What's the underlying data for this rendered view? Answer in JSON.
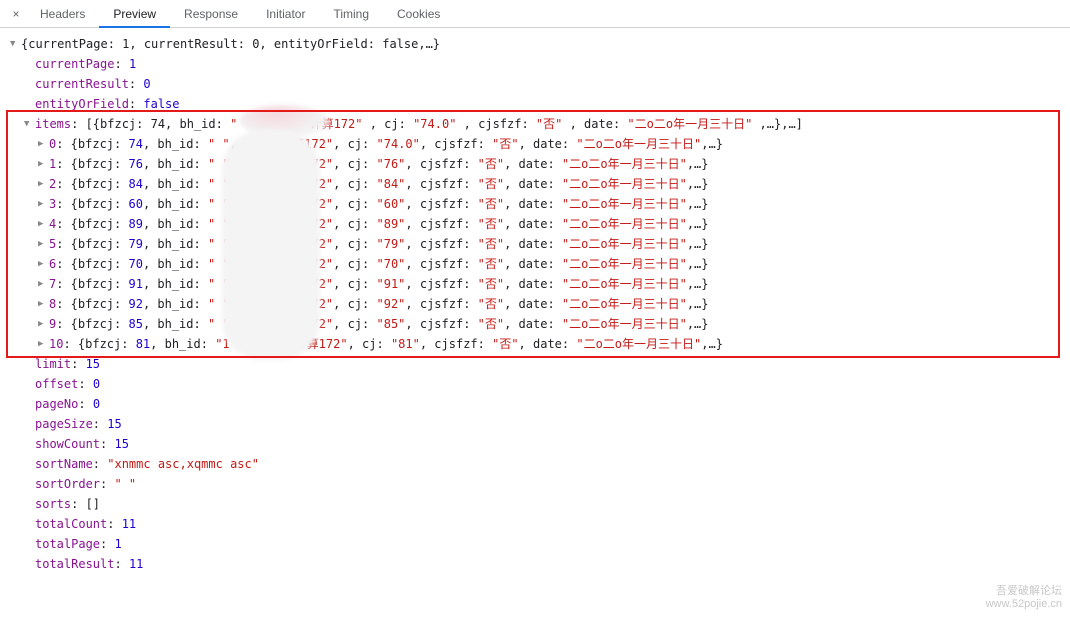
{
  "tabs": {
    "close": "×",
    "headers": "Headers",
    "preview": "Preview",
    "response": "Response",
    "initiator": "Initiator",
    "timing": "Timing",
    "cookies": "Cookies"
  },
  "glyph": {
    "down": "▼",
    "right": "▶"
  },
  "root_summary": "{currentPage: 1, currentResult: 0, entityOrField: false,…}",
  "simple_before": [
    {
      "key": "currentPage",
      "value": "1",
      "type": "num"
    },
    {
      "key": "currentResult",
      "value": "0",
      "type": "num"
    },
    {
      "key": "entityOrField",
      "value": "false",
      "type": "bool"
    }
  ],
  "items_header": {
    "key": "items",
    "summary_front": "[{bfzcj: 74, bh_id: ",
    "bh_id": "\"           \"",
    "bj_label": ", bj: ",
    "bj": "\"计算172\"",
    "cj_label": ", cj: ",
    "cj": "\"74.0\"",
    "cjs_label": ", cjsfzf: ",
    "cjs": "\"否\"",
    "date_label": ", date: ",
    "date": "\"二o二o年一月三十日\"",
    "trail": ",…},…]"
  },
  "items": [
    {
      "idx": "0",
      "bfzcj": "74",
      "cj": "\"74.0\"",
      "bh_id": "\"         \"",
      "lead_bj": ", bj: "
    },
    {
      "idx": "1",
      "bfzcj": "76",
      "cj": "\"76\"",
      "bh_id": "\"         \"",
      "lead_bj": ", bj: "
    },
    {
      "idx": "2",
      "bfzcj": "84",
      "cj": "\"84\"",
      "bh_id": "\"         \"",
      "lead_bj": ", bj: "
    },
    {
      "idx": "3",
      "bfzcj": "60",
      "cj": "\"60\"",
      "bh_id": "\"         \"",
      "lead_bj": ", bj: "
    },
    {
      "idx": "4",
      "bfzcj": "89",
      "cj": "\"89\"",
      "bh_id": "\"         \"",
      "lead_bj": ", bj: "
    },
    {
      "idx": "5",
      "bfzcj": "79",
      "cj": "\"79\"",
      "bh_id": "\"         \"",
      "lead_bj": ", bj: "
    },
    {
      "idx": "6",
      "bfzcj": "70",
      "cj": "\"70\"",
      "bh_id": "\"         \"",
      "lead_bj": ", bj: "
    },
    {
      "idx": "7",
      "bfzcj": "91",
      "cj": "\"91\"",
      "bh_id": "\"         \"",
      "lead_bj": ", bj: "
    },
    {
      "idx": "8",
      "bfzcj": "92",
      "cj": "\"92\"",
      "bh_id": "\"         \"",
      "lead_bj": ", bj: "
    },
    {
      "idx": "9",
      "bfzcj": "85",
      "cj": "\"85\"",
      "bh_id": "\"         \"",
      "lead_bj": ", bj: "
    },
    {
      "idx": "10",
      "bfzcj": "81",
      "cj": "\"81\"",
      "bh_id": "\"1        \"",
      "lead_bj": ", bj: "
    }
  ],
  "item_shared": {
    "bj": "\"计算172\"",
    "cjs": "\"否\"",
    "date": "\"二o二o年一月三十日\"",
    "trail": ",…}"
  },
  "simple_after": [
    {
      "key": "limit",
      "value": "15",
      "type": "num"
    },
    {
      "key": "offset",
      "value": "0",
      "type": "num"
    },
    {
      "key": "pageNo",
      "value": "0",
      "type": "num"
    },
    {
      "key": "pageSize",
      "value": "15",
      "type": "num"
    },
    {
      "key": "showCount",
      "value": "15",
      "type": "num"
    },
    {
      "key": "sortName",
      "value": "\"xnmmc asc,xqmmc asc\"",
      "type": "str"
    },
    {
      "key": "sortOrder",
      "value": "\" \"",
      "type": "str"
    },
    {
      "key": "sorts",
      "value": "[]",
      "type": "punct"
    },
    {
      "key": "totalCount",
      "value": "11",
      "type": "num"
    },
    {
      "key": "totalPage",
      "value": "1",
      "type": "num"
    },
    {
      "key": "totalResult",
      "value": "11",
      "type": "num"
    }
  ],
  "watermark": {
    "l1": "吾爱破解论坛",
    "l2": "www.52pojie.cn"
  }
}
